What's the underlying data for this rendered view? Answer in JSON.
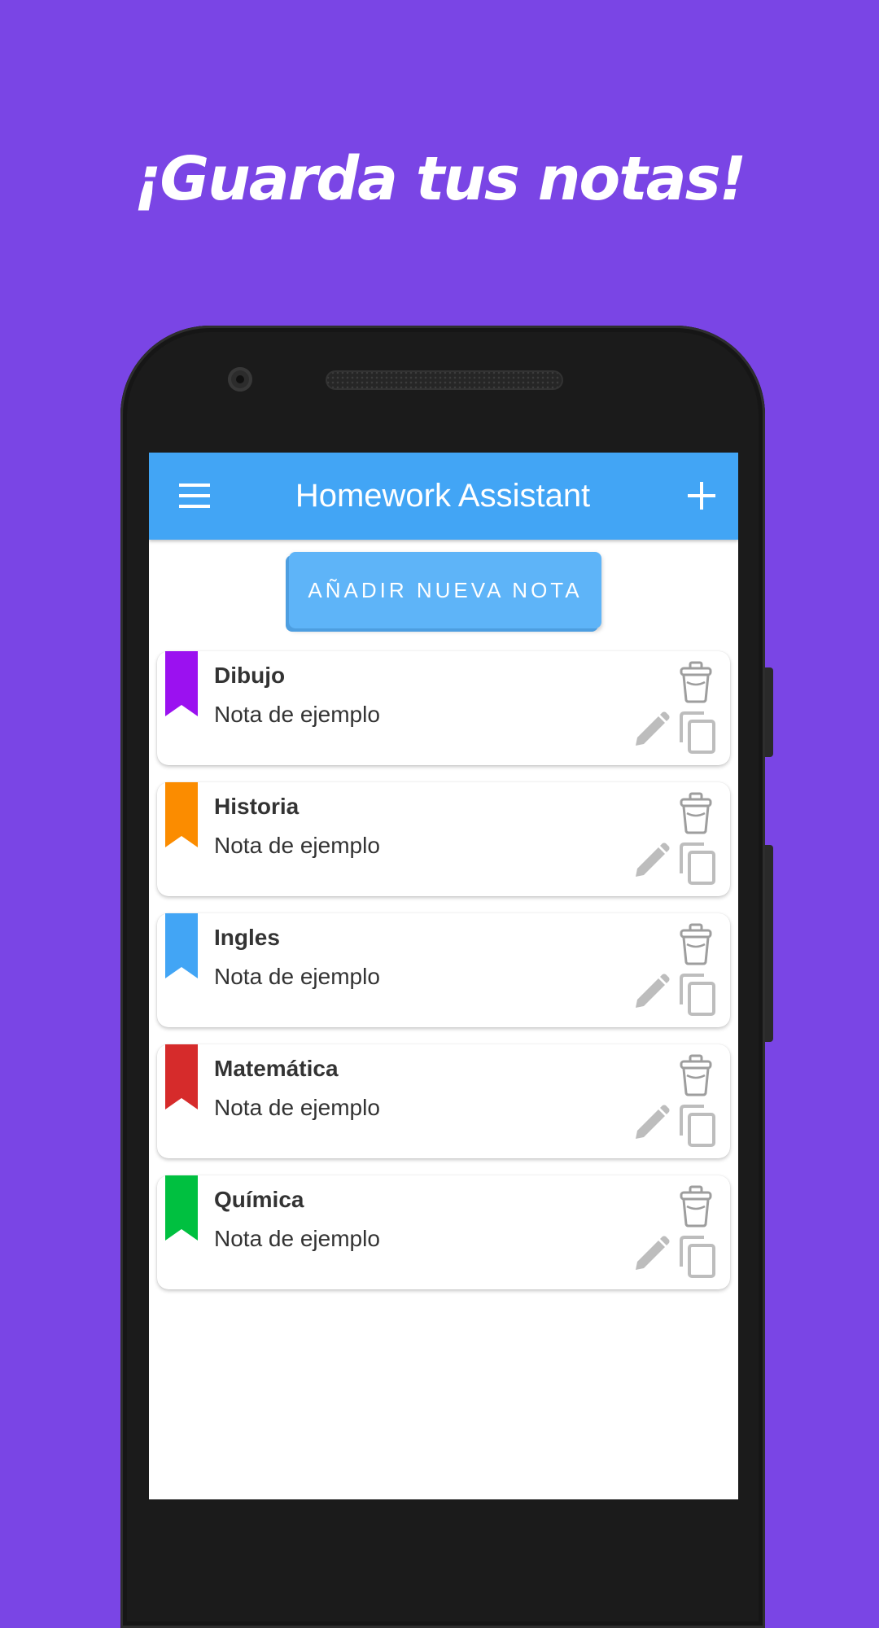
{
  "headline": "¡Guarda tus notas!",
  "appbar": {
    "title": "Homework Assistant",
    "menu_icon": "menu-icon",
    "add_icon": "add-icon"
  },
  "add_note_button": "AÑADIR NUEVA NOTA",
  "colors": {
    "background": "#7a45e5",
    "appbar": "#42a5f5",
    "button": "#5eb4f8"
  },
  "notes": [
    {
      "title": "Dibujo",
      "body": "Nota de ejemplo",
      "color": "#9b11f0"
    },
    {
      "title": "Historia",
      "body": "Nota de ejemplo",
      "color": "#fb8c00"
    },
    {
      "title": "Ingles",
      "body": "Nota de ejemplo",
      "color": "#42a5f5"
    },
    {
      "title": "Matemática",
      "body": "Nota de ejemplo",
      "color": "#d62b2b"
    },
    {
      "title": "Química",
      "body": "Nota de ejemplo",
      "color": "#00c040"
    }
  ],
  "note_actions": [
    "trash-icon",
    "edit-icon",
    "copy-icon"
  ]
}
